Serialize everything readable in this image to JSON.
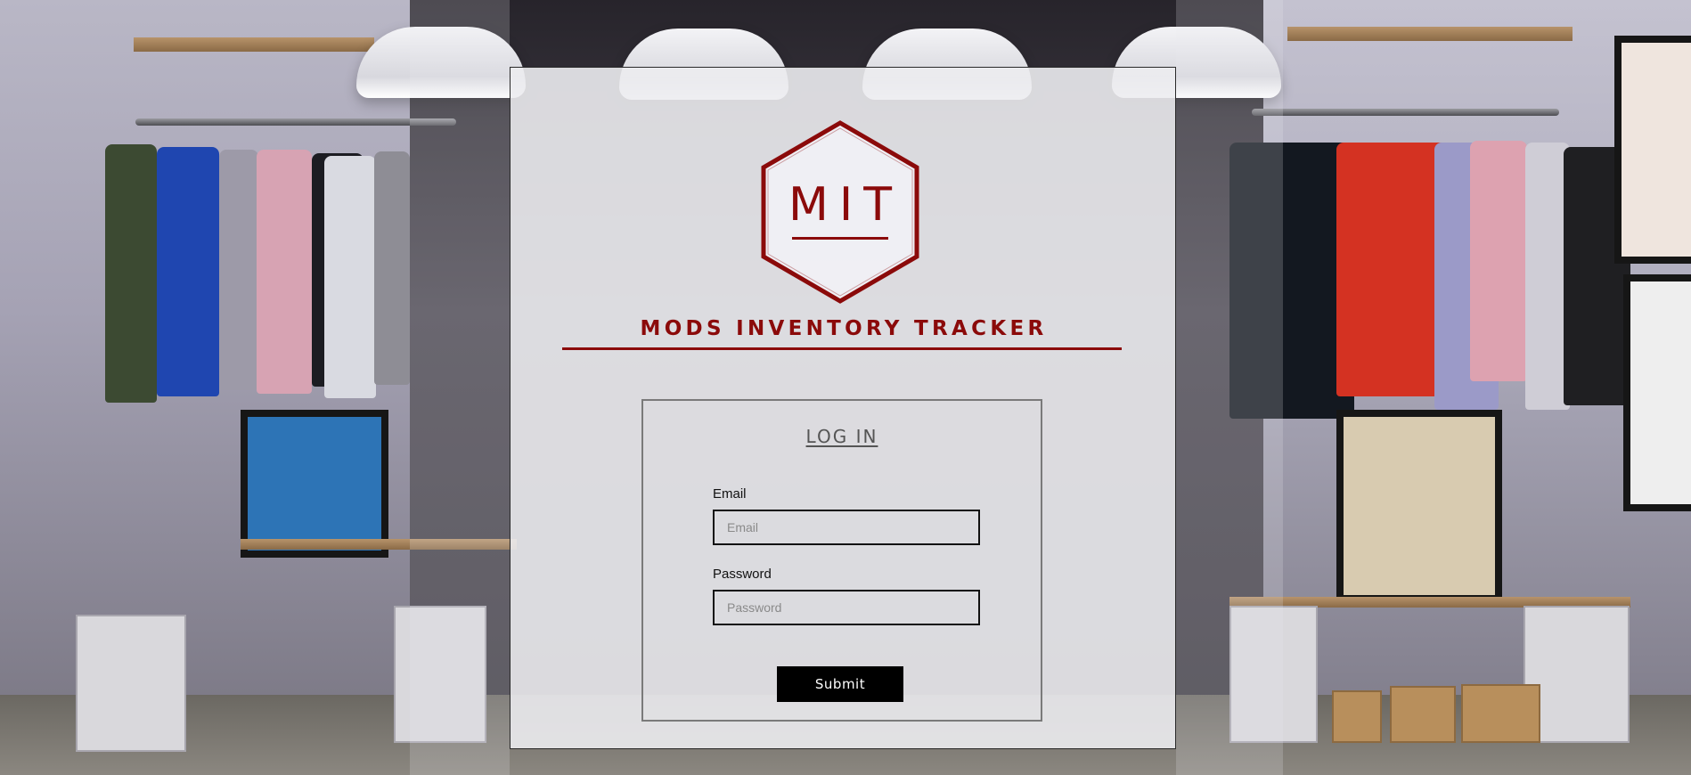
{
  "brand": {
    "logo_text": "MIT",
    "title": "MODS INVENTORY TRACKER"
  },
  "login": {
    "heading": "LOG IN",
    "email": {
      "label": "Email",
      "placeholder": "Email",
      "value": ""
    },
    "password": {
      "label": "Password",
      "placeholder": "Password",
      "value": ""
    },
    "submit_label": "Submit"
  },
  "colors": {
    "accent": "#8b0a0a",
    "button_bg": "#000000",
    "button_text": "#ffffff"
  },
  "background": {
    "description_icon": "clothing-store-photo"
  }
}
